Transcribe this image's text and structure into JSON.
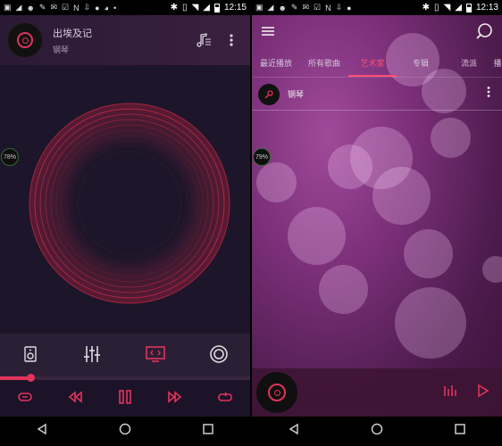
{
  "left": {
    "status": {
      "time": "12:15"
    },
    "now_playing": {
      "title": "出埃及记",
      "artist": "钢琴"
    },
    "visualizer_percent": "78%",
    "progress": 0.12,
    "tools": [
      "speaker-icon",
      "equalizer-icon",
      "screen-cast-icon",
      "surround-icon"
    ],
    "controls": [
      "shuffle-icon",
      "rewind-icon",
      "pause-icon",
      "fast-forward-icon",
      "repeat-icon"
    ]
  },
  "right": {
    "status": {
      "time": "12:13"
    },
    "tabs": [
      {
        "label": "最近播放",
        "active": false
      },
      {
        "label": "所有歌曲",
        "active": false
      },
      {
        "label": "艺术家",
        "active": true
      },
      {
        "label": "专辑",
        "active": false
      },
      {
        "label": "流派",
        "active": false
      },
      {
        "label": "播",
        "active": false
      }
    ],
    "artist_row": {
      "name": "钢琴"
    },
    "visualizer_percent": "79%"
  },
  "colors": {
    "accent": "#e0345b",
    "bg_left": "#1d1529",
    "bg_right": "#7a2f78"
  }
}
